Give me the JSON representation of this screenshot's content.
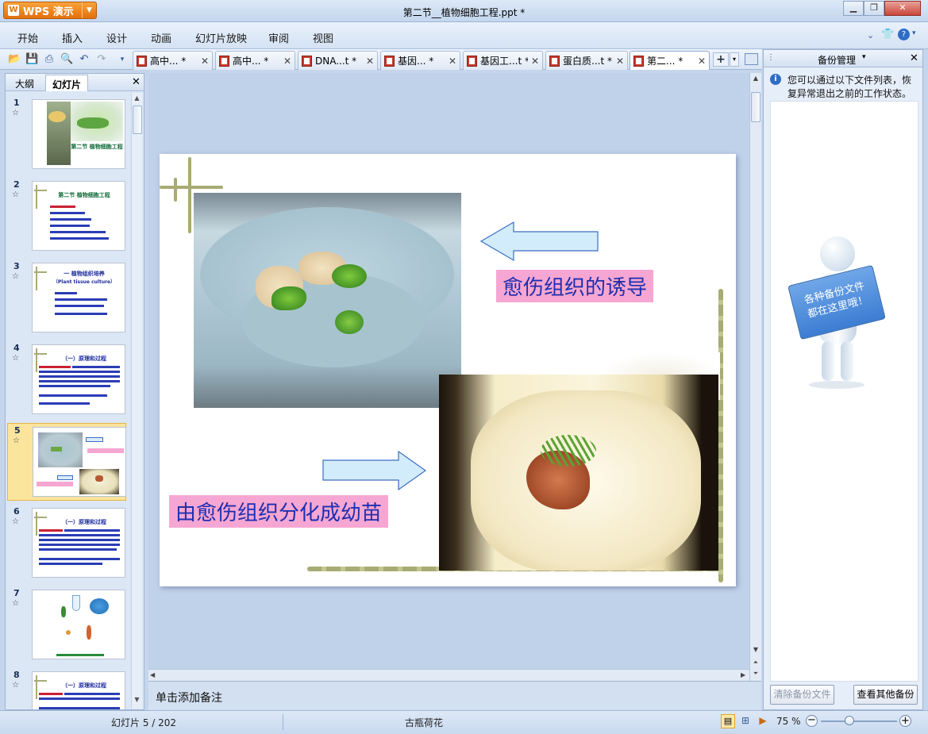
{
  "app": {
    "name": "WPS 演示",
    "title": "第二节__植物细胞工程.ppt *"
  },
  "menu": [
    "开始",
    "插入",
    "设计",
    "动画",
    "幻灯片放映",
    "审阅",
    "视图"
  ],
  "doc_tabs": [
    {
      "label": "高中... *",
      "active": false
    },
    {
      "label": "高中... *",
      "active": false
    },
    {
      "label": "DNA...t *",
      "active": false
    },
    {
      "label": "基因... *",
      "active": false
    },
    {
      "label": "基因工...t *",
      "active": false
    },
    {
      "label": "蛋白质...t *",
      "active": false
    },
    {
      "label": "第二... *",
      "active": true
    }
  ],
  "left_panel": {
    "tabs": [
      "大纲",
      "幻灯片"
    ],
    "active_tab": "幻灯片",
    "slides": [
      {
        "number": "1",
        "title": "第二节 植物细胞工程",
        "selected": false
      },
      {
        "number": "2",
        "title": "第二节 植物细胞工程",
        "selected": false
      },
      {
        "number": "3",
        "title": "一 植物组织培养",
        "subtitle": "（Plant tissue culture）",
        "selected": false
      },
      {
        "number": "4",
        "title": "（一）原理和过程",
        "selected": false
      },
      {
        "number": "5",
        "title": "",
        "selected": true
      },
      {
        "number": "6",
        "title": "（一）原理和过程",
        "selected": false
      },
      {
        "number": "7",
        "title": "",
        "selected": false
      },
      {
        "number": "8",
        "title": "（一）原理和过程",
        "selected": false
      }
    ]
  },
  "slide": {
    "caption_top": "愈伤组织的诱导",
    "caption_bottom": "由愈伤组织分化成幼苗"
  },
  "notes_placeholder": "单击添加备注",
  "right_panel": {
    "title": "备份管理",
    "info": "您可以通过以下文件列表，恢复异常退出之前的工作状态。",
    "sign_text_line1": "各种备份文件",
    "sign_text_line2": "都在这里哦！",
    "btn_clear": "清除备份文件",
    "btn_view": "查看其他备份"
  },
  "status": {
    "slide_counter": "幻灯片 5 / 202",
    "theme": "古瓶荷花",
    "zoom": "75 %"
  },
  "colors": {
    "caption_bg": "#f6a6d2",
    "caption_text": "#1d2fb0",
    "accent_orange": "#e3700c",
    "selected_slide": "#fbe49c"
  }
}
